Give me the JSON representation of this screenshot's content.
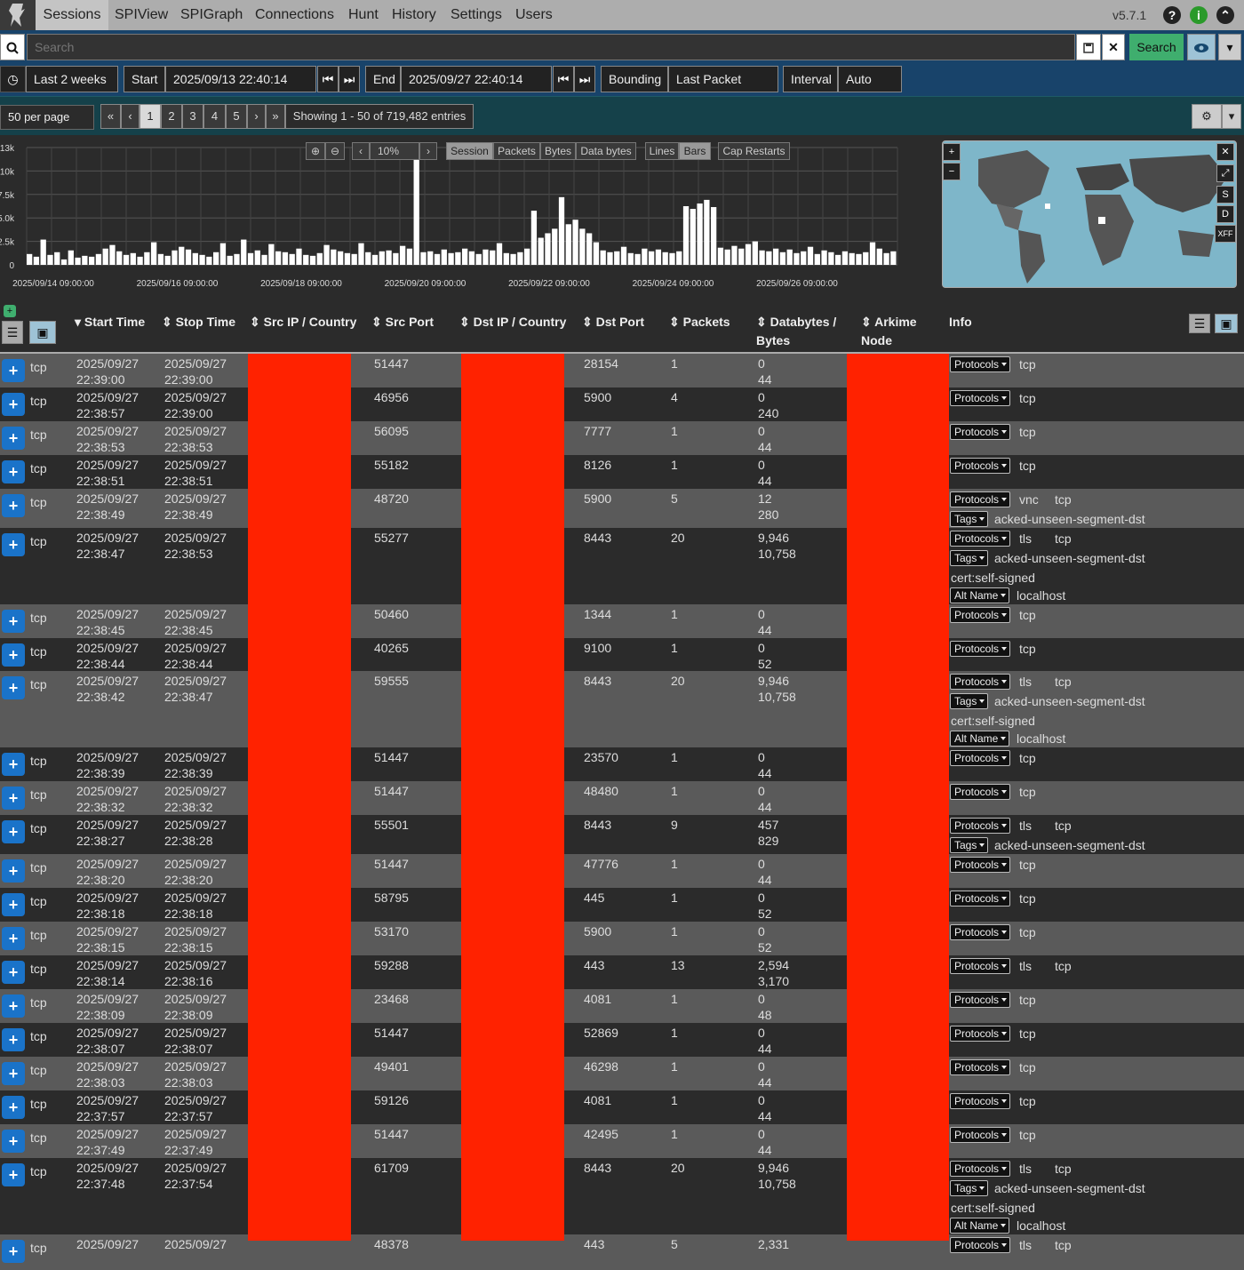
{
  "nav": {
    "tabs": [
      "Sessions",
      "SPIView",
      "SPIGraph",
      "Connections",
      "Hunt",
      "History",
      "Settings",
      "Users"
    ],
    "version": "v5.7.1"
  },
  "search": {
    "placeholder": "Search",
    "button": "Search"
  },
  "time": {
    "range": "Last 2 weeks",
    "start_label": "Start",
    "start": "2025/09/13 22:40:14",
    "end_label": "End",
    "end": "2025/09/27 22:40:14",
    "bounding_label": "Bounding",
    "bounding": "Last Packet",
    "interval_label": "Interval",
    "interval": "Auto"
  },
  "paging": {
    "per_page": "50 per page",
    "pages": [
      "«",
      "‹",
      "1",
      "2",
      "3",
      "4",
      "5",
      "›",
      "»"
    ],
    "showing": "Showing 1 - 50 of 719,482 entries"
  },
  "chart_controls": {
    "zoom": "10%",
    "types": [
      "Session",
      "Packets",
      "Bytes",
      "Data bytes"
    ],
    "styles": [
      "Lines",
      "Bars"
    ],
    "extra": "Cap Restarts"
  },
  "chart_data": {
    "type": "bar",
    "y_ticks": [
      "13k",
      "10k",
      "7.5k",
      "5.0k",
      "2.5k",
      "0"
    ],
    "x_ticks": [
      "2025/09/14 09:00:00",
      "2025/09/16 09:00:00",
      "2025/09/18 09:00:00",
      "2025/09/20 09:00:00",
      "2025/09/22 09:00:00",
      "2025/09/24 09:00:00",
      "2025/09/26 09:00:00"
    ],
    "ylim": [
      0,
      13000
    ],
    "series": [
      {
        "values": [
          1200,
          900,
          2800,
          1100,
          1400,
          600,
          1600,
          800,
          1000,
          900,
          1200,
          1800,
          2200,
          1500,
          1100,
          1300,
          900,
          1400,
          2500,
          1200,
          1000,
          1600,
          2000,
          1700,
          1300,
          1100,
          900,
          1400,
          2400,
          1000,
          1200,
          2800,
          1300,
          1600,
          1100,
          2300,
          1500,
          1400,
          1200,
          1800,
          1100,
          1000,
          1300,
          2200,
          1700,
          1500,
          1300,
          1200,
          2400,
          1400,
          1100,
          1500,
          1600,
          1300,
          2100,
          1800,
          12000,
          1400,
          1500,
          1200,
          1700,
          1300,
          1400,
          1800,
          1500,
          1200,
          1700,
          1600,
          2400,
          1300,
          1200,
          1400,
          1800,
          6000,
          3000,
          3500,
          4000,
          7500,
          4500,
          5000,
          4000,
          3500,
          2500,
          1600,
          1400,
          1500,
          2000,
          1300,
          1200,
          1800,
          1500,
          1700,
          1400,
          1300,
          1500,
          6500,
          6200,
          6800,
          7200,
          6400,
          1900,
          1700,
          2100,
          1800,
          2300,
          2600,
          1600,
          1500,
          1800,
          1400,
          1700,
          1300,
          1500,
          2000,
          1200,
          1600,
          1400,
          1100,
          1500,
          1300,
          1200,
          1400,
          2500,
          1800,
          1300,
          1500
        ]
      }
    ]
  },
  "map_buttons": [
    "S",
    "D",
    "XFF"
  ],
  "columns": [
    "Start Time",
    "Stop Time",
    "Src IP / Country",
    "Src Port",
    "Dst IP / Country",
    "Dst Port",
    "Packets",
    "Databytes / Bytes",
    "Arkime Node",
    "Info"
  ],
  "labels": {
    "protocols": "Protocols",
    "tags": "Tags",
    "altname": "Alt Name"
  },
  "rows": [
    {
      "proto": "tcp",
      "sd": "2025/09/27",
      "st": "22:39:00",
      "ed": "2025/09/27",
      "et": "22:39:00",
      "sport": "51447",
      "dport": "28154",
      "pkts": "1",
      "db": "0",
      "b": "44",
      "protos": [
        "tcp"
      ]
    },
    {
      "proto": "tcp",
      "sd": "2025/09/27",
      "st": "22:38:57",
      "ed": "2025/09/27",
      "et": "22:39:00",
      "sport": "46956",
      "dport": "5900",
      "pkts": "4",
      "db": "0",
      "b": "240",
      "protos": [
        "tcp"
      ]
    },
    {
      "proto": "tcp",
      "sd": "2025/09/27",
      "st": "22:38:53",
      "ed": "2025/09/27",
      "et": "22:38:53",
      "sport": "56095",
      "dport": "7777",
      "pkts": "1",
      "db": "0",
      "b": "44",
      "protos": [
        "tcp"
      ]
    },
    {
      "proto": "tcp",
      "sd": "2025/09/27",
      "st": "22:38:51",
      "ed": "2025/09/27",
      "et": "22:38:51",
      "sport": "55182",
      "dport": "8126",
      "pkts": "1",
      "db": "0",
      "b": "44",
      "protos": [
        "tcp"
      ]
    },
    {
      "proto": "tcp",
      "sd": "2025/09/27",
      "st": "22:38:49",
      "ed": "2025/09/27",
      "et": "22:38:49",
      "sport": "48720",
      "dport": "5900",
      "pkts": "5",
      "db": "12",
      "b": "280",
      "protos": [
        "vnc",
        "tcp"
      ],
      "tags": "acked-unseen-segment-dst"
    },
    {
      "proto": "tcp",
      "sd": "2025/09/27",
      "st": "22:38:47",
      "ed": "2025/09/27",
      "et": "22:38:53",
      "sport": "55277",
      "dport": "8443",
      "pkts": "20",
      "db": "9,946",
      "b": "10,758",
      "protos": [
        "tls",
        "tcp"
      ],
      "tags": "acked-unseen-segment-dst",
      "cert": "cert:self-signed",
      "alt": "localhost"
    },
    {
      "proto": "tcp",
      "sd": "2025/09/27",
      "st": "22:38:45",
      "ed": "2025/09/27",
      "et": "22:38:45",
      "sport": "50460",
      "dport": "1344",
      "pkts": "1",
      "db": "0",
      "b": "44",
      "protos": [
        "tcp"
      ]
    },
    {
      "proto": "tcp",
      "sd": "2025/09/27",
      "st": "22:38:44",
      "ed": "2025/09/27",
      "et": "22:38:44",
      "sport": "40265",
      "dport": "9100",
      "pkts": "1",
      "db": "0",
      "b": "52",
      "protos": [
        "tcp"
      ]
    },
    {
      "proto": "tcp",
      "sd": "2025/09/27",
      "st": "22:38:42",
      "ed": "2025/09/27",
      "et": "22:38:47",
      "sport": "59555",
      "dport": "8443",
      "pkts": "20",
      "db": "9,946",
      "b": "10,758",
      "protos": [
        "tls",
        "tcp"
      ],
      "tags": "acked-unseen-segment-dst",
      "cert": "cert:self-signed",
      "alt": "localhost"
    },
    {
      "proto": "tcp",
      "sd": "2025/09/27",
      "st": "22:38:39",
      "ed": "2025/09/27",
      "et": "22:38:39",
      "sport": "51447",
      "dport": "23570",
      "pkts": "1",
      "db": "0",
      "b": "44",
      "protos": [
        "tcp"
      ]
    },
    {
      "proto": "tcp",
      "sd": "2025/09/27",
      "st": "22:38:32",
      "ed": "2025/09/27",
      "et": "22:38:32",
      "sport": "51447",
      "dport": "48480",
      "pkts": "1",
      "db": "0",
      "b": "44",
      "protos": [
        "tcp"
      ]
    },
    {
      "proto": "tcp",
      "sd": "2025/09/27",
      "st": "22:38:27",
      "ed": "2025/09/27",
      "et": "22:38:28",
      "sport": "55501",
      "dport": "8443",
      "pkts": "9",
      "db": "457",
      "b": "829",
      "protos": [
        "tls",
        "tcp"
      ],
      "tags": "acked-unseen-segment-dst"
    },
    {
      "proto": "tcp",
      "sd": "2025/09/27",
      "st": "22:38:20",
      "ed": "2025/09/27",
      "et": "22:38:20",
      "sport": "51447",
      "dport": "47776",
      "pkts": "1",
      "db": "0",
      "b": "44",
      "protos": [
        "tcp"
      ]
    },
    {
      "proto": "tcp",
      "sd": "2025/09/27",
      "st": "22:38:18",
      "ed": "2025/09/27",
      "et": "22:38:18",
      "sport": "58795",
      "dport": "445",
      "pkts": "1",
      "db": "0",
      "b": "52",
      "protos": [
        "tcp"
      ]
    },
    {
      "proto": "tcp",
      "sd": "2025/09/27",
      "st": "22:38:15",
      "ed": "2025/09/27",
      "et": "22:38:15",
      "sport": "53170",
      "dport": "5900",
      "pkts": "1",
      "db": "0",
      "b": "52",
      "protos": [
        "tcp"
      ]
    },
    {
      "proto": "tcp",
      "sd": "2025/09/27",
      "st": "22:38:14",
      "ed": "2025/09/27",
      "et": "22:38:16",
      "sport": "59288",
      "dport": "443",
      "pkts": "13",
      "db": "2,594",
      "b": "3,170",
      "protos": [
        "tls",
        "tcp"
      ]
    },
    {
      "proto": "tcp",
      "sd": "2025/09/27",
      "st": "22:38:09",
      "ed": "2025/09/27",
      "et": "22:38:09",
      "sport": "23468",
      "dport": "4081",
      "pkts": "1",
      "db": "0",
      "b": "48",
      "protos": [
        "tcp"
      ]
    },
    {
      "proto": "tcp",
      "sd": "2025/09/27",
      "st": "22:38:07",
      "ed": "2025/09/27",
      "et": "22:38:07",
      "sport": "51447",
      "dport": "52869",
      "pkts": "1",
      "db": "0",
      "b": "44",
      "protos": [
        "tcp"
      ]
    },
    {
      "proto": "tcp",
      "sd": "2025/09/27",
      "st": "22:38:03",
      "ed": "2025/09/27",
      "et": "22:38:03",
      "sport": "49401",
      "dport": "46298",
      "pkts": "1",
      "db": "0",
      "b": "44",
      "protos": [
        "tcp"
      ]
    },
    {
      "proto": "tcp",
      "sd": "2025/09/27",
      "st": "22:37:57",
      "ed": "2025/09/27",
      "et": "22:37:57",
      "sport": "59126",
      "dport": "4081",
      "pkts": "1",
      "db": "0",
      "b": "44",
      "protos": [
        "tcp"
      ]
    },
    {
      "proto": "tcp",
      "sd": "2025/09/27",
      "st": "22:37:49",
      "ed": "2025/09/27",
      "et": "22:37:49",
      "sport": "51447",
      "dport": "42495",
      "pkts": "1",
      "db": "0",
      "b": "44",
      "protos": [
        "tcp"
      ]
    },
    {
      "proto": "tcp",
      "sd": "2025/09/27",
      "st": "22:37:48",
      "ed": "2025/09/27",
      "et": "22:37:54",
      "sport": "61709",
      "dport": "8443",
      "pkts": "20",
      "db": "9,946",
      "b": "10,758",
      "protos": [
        "tls",
        "tcp"
      ],
      "tags": "acked-unseen-segment-dst",
      "cert": "cert:self-signed",
      "alt": "localhost"
    },
    {
      "proto": "tcp",
      "sd": "2025/09/27",
      "st": "",
      "ed": "2025/09/27",
      "et": "",
      "sport": "48378",
      "dport": "443",
      "pkts": "5",
      "db": "2,331",
      "b": "",
      "protos": [
        "tls",
        "tcp"
      ]
    }
  ]
}
